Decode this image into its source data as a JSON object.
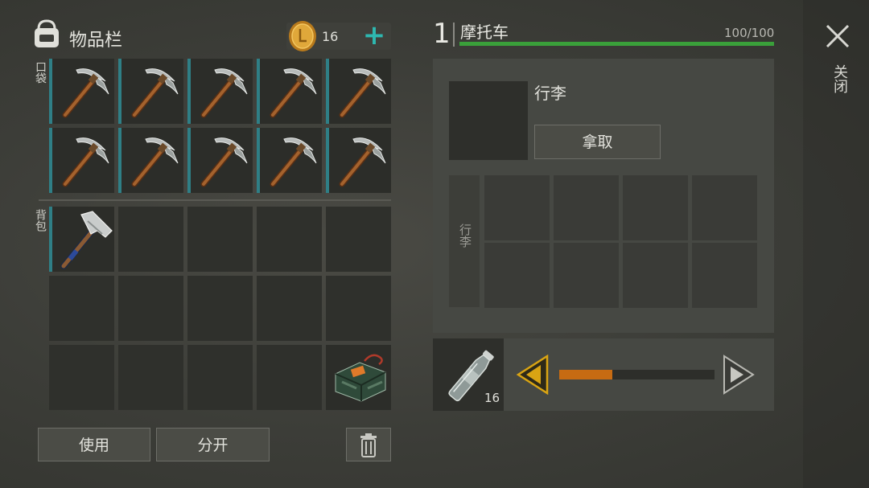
{
  "inventory": {
    "title": "物品栏",
    "coin_count": "16",
    "add_label": "+",
    "pocket_label": "口袋",
    "backpack_label": "背包",
    "pocket_items": [
      "pickaxe",
      "pickaxe",
      "pickaxe",
      "pickaxe",
      "pickaxe",
      "pickaxe",
      "pickaxe",
      "pickaxe",
      "pickaxe",
      "pickaxe"
    ],
    "backpack_items": [
      "hammer",
      "",
      "",
      "",
      "",
      "",
      "",
      "",
      "",
      "",
      "",
      "",
      "",
      "",
      "explosive-pack"
    ]
  },
  "actions": {
    "use_label": "使用",
    "split_label": "分开"
  },
  "vehicle": {
    "slot_number": "1",
    "name": "摩托车",
    "durability_text": "100/100",
    "durability_fraction": 1.0,
    "luggage_title": "行李",
    "take_label": "拿取",
    "luggage_grid_label": "行李"
  },
  "fuel": {
    "item": "water-bottle",
    "count": "16",
    "slider_fraction": 0.34
  },
  "close_label": "关闭",
  "colors": {
    "accent_teal": "#2f7f86",
    "durability_green": "#3aa03a",
    "slider_orange": "#c76b12",
    "arrow_gold": "#d9a413"
  }
}
